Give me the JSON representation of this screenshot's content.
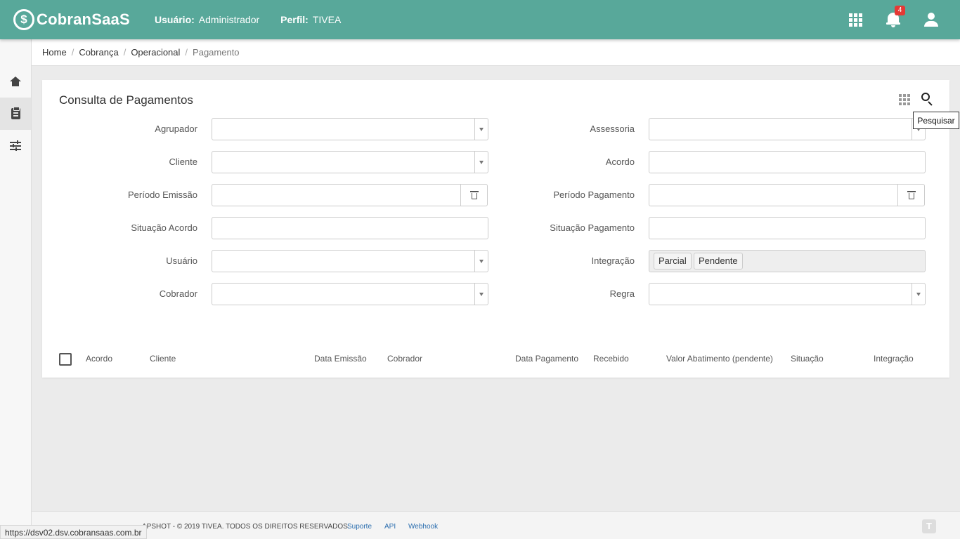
{
  "header": {
    "logo_symbol": "$",
    "logo_text": "CobranSaaS",
    "user_label": "Usuário:",
    "user_value": "Administrador",
    "profile_label": "Perfil:",
    "profile_value": "TIVEA",
    "notification_count": "4",
    "color": "#58a89a"
  },
  "breadcrumb": [
    "Home",
    "Cobrança",
    "Operacional",
    "Pagamento"
  ],
  "card": {
    "title": "Consulta de Pagamentos",
    "search_tooltip": "Pesquisar"
  },
  "form": {
    "left": [
      {
        "label": "Agrupador",
        "type": "select",
        "value": ""
      },
      {
        "label": "Cliente",
        "type": "select",
        "value": ""
      },
      {
        "label": "Período Emissão",
        "type": "daterange",
        "value": ""
      },
      {
        "label": "Situação Acordo",
        "type": "text",
        "value": ""
      },
      {
        "label": "Usuário",
        "type": "select",
        "value": ""
      },
      {
        "label": "Cobrador",
        "type": "select",
        "value": ""
      }
    ],
    "right": [
      {
        "label": "Assessoria",
        "type": "select",
        "value": ""
      },
      {
        "label": "Acordo",
        "type": "text",
        "value": ""
      },
      {
        "label": "Período Pagamento",
        "type": "daterange",
        "value": ""
      },
      {
        "label": "Situação Pagamento",
        "type": "text",
        "value": ""
      },
      {
        "label": "Integração",
        "type": "tags",
        "tags": [
          "Parcial",
          "Pendente"
        ]
      },
      {
        "label": "Regra",
        "type": "select",
        "value": ""
      }
    ]
  },
  "table": {
    "columns": [
      "Acordo",
      "Cliente",
      "Data Emissão",
      "Cobrador",
      "Data Pagamento",
      "Recebido",
      "Valor Abatimento (pendente)",
      "Situação",
      "Integração"
    ]
  },
  "footer": {
    "copyright": "APSHOT - © 2019 TIVEA. TODOS OS DIREITOS RESERVADOS.",
    "links": [
      "Suporte",
      "API",
      "Webhook"
    ]
  },
  "status_url": "https://dsv02.dsv.cobransaas.com.br"
}
